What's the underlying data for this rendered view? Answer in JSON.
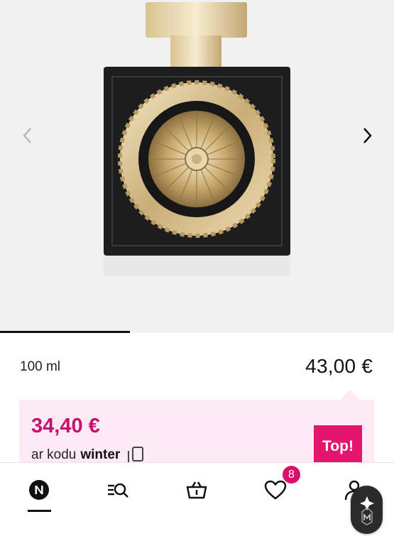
{
  "product": {
    "size": "100 ml",
    "price": "43,00 €"
  },
  "gallery": {
    "progress_fraction": 0.33
  },
  "promo": {
    "price": "34,40 €",
    "code_prefix": "ar kodu",
    "code": "winter",
    "badge": "Top!"
  },
  "bottom_nav": {
    "items": [
      {
        "icon": "notino-logo-icon",
        "active": true
      },
      {
        "icon": "search-list-icon"
      },
      {
        "icon": "basket-icon"
      },
      {
        "icon": "heart-icon",
        "badge": "8"
      },
      {
        "icon": "user-icon"
      }
    ]
  },
  "colors": {
    "accent": "#c8106d",
    "badge_bg": "#e4156f",
    "promo_bg": "#fdeaf5"
  }
}
